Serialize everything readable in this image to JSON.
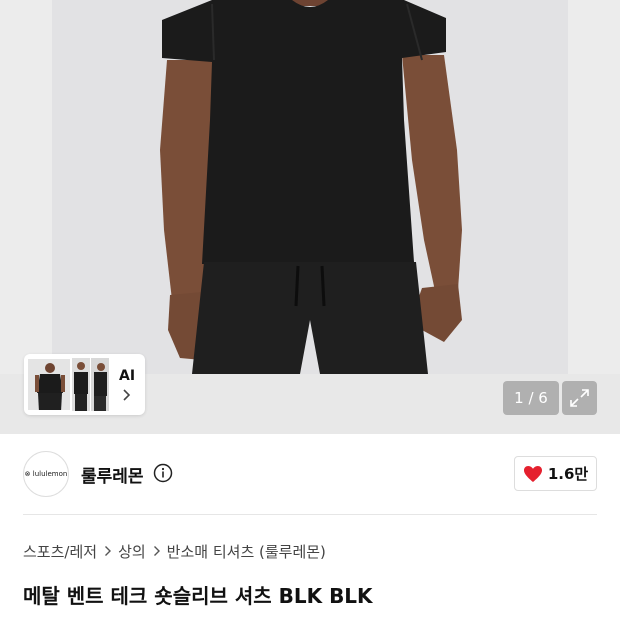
{
  "gallery": {
    "ai_label": "AI",
    "pager": "1 / 6",
    "thumbnail_count": 3
  },
  "brand": {
    "logo_text": "⊗ lululemon",
    "name": "룰루레몬",
    "like_count": "1.6만"
  },
  "breadcrumb": [
    "스포츠/레저",
    "상의",
    "반소매 티셔츠 (룰루레몬)"
  ],
  "product": {
    "title": "메탈 벤트 테크 숏슬리브 셔츠 BLK BLK"
  },
  "colors": {
    "heart": "#e5202e",
    "shirt": "#1b1b1b",
    "skin": "#7a4e38",
    "photo_background": "#e2e2e4"
  },
  "icons": {
    "info": "info-circle-icon",
    "expand": "expand-arrows-icon",
    "heart": "heart-icon",
    "chevron": "chevron-right-icon"
  }
}
